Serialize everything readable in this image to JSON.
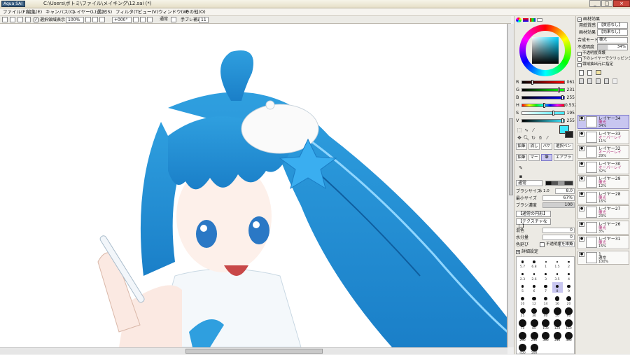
{
  "window": {
    "logo": "Aqua SAI",
    "title": "C:\\Users\\ボトミ\\ファイル\\メイキング\\12.sai (*)",
    "min": "_",
    "max": "□",
    "close": "×"
  },
  "menu": [
    "ファイル(F)",
    "編集(E)",
    "キャンバス(C)",
    "レイヤー(L)",
    "選択(S)",
    "フィルタ(T)",
    "ビュー(V)",
    "ウィンドウ(W)",
    "その他(O)"
  ],
  "toolbar": {
    "show_selection_label": "選択領域表示",
    "zoom": "100%",
    "angle": "+000°",
    "blend": "通常",
    "stabilizer_label": "手ブレ補正",
    "stabilizer": "11"
  },
  "color": {
    "sliders": [
      {
        "label": "R",
        "value": "061",
        "gradient": "linear-gradient(90deg,#000,#f00)",
        "level": 0.24
      },
      {
        "label": "G",
        "value": "231",
        "gradient": "linear-gradient(90deg,#000,#0f0)",
        "level": 0.91
      },
      {
        "label": "B",
        "value": "255",
        "gradient": "linear-gradient(90deg,#000,#00f)",
        "level": 1.0
      },
      {
        "label": "H",
        "value": "0.532",
        "gradient": "linear-gradient(90deg,#f00,#ff0,#0f0,#0ff,#00f,#f0f,#f00)",
        "level": 0.53
      },
      {
        "label": "S",
        "value": "195",
        "gradient": "linear-gradient(90deg,#fff,#3de7ff)",
        "level": 0.76
      },
      {
        "label": "V",
        "value": "255",
        "gradient": "linear-gradient(90deg,#000,#3de7ff)",
        "level": 1.0
      }
    ],
    "current": "#3de7ff",
    "brush_row1": [
      "鉛筆",
      "消しゴム",
      "バケツ",
      "選択ペン"
    ],
    "brush_row2": [
      "鉛筆",
      "マーカー",
      "筆",
      "エアブラシ"
    ],
    "blend_mode": "通常",
    "brush_size_label": "ブラシサイズ",
    "brush_size_mult": "x 1.0",
    "brush_size": "8.0",
    "min_size_label": "最小サイズ",
    "min_size": "67%",
    "density_label": "ブラシ濃度",
    "density": "100",
    "shape_label": "【通常の円形】",
    "texture_label": "【テクスチャなし】",
    "blend_label": "混色",
    "blend_val": "0",
    "water_label": "水分量",
    "water_val": "0",
    "stretch_label": "色延び",
    "stretch_val": "0",
    "keep_opacity_label": "不透明度を維持",
    "detail_label": "詳細設定",
    "sizes": [
      "5.7",
      "6.8",
      "1",
      "1.5",
      "2",
      "2.3",
      "2.6",
      "3",
      "3.5",
      "4",
      "5",
      "6",
      "7",
      "8",
      "9",
      "10",
      "12",
      "14",
      "16",
      "20",
      "25",
      "30",
      "40",
      "50",
      "60",
      "70",
      "80",
      "100",
      "120",
      "160",
      "200",
      "250",
      "300",
      "350",
      "400",
      "450",
      "500"
    ]
  },
  "layers": {
    "texture_header": "画材効果",
    "paper_label": "用紙質感",
    "paper_value": "【質感なし】",
    "effect_label": "画材効果",
    "effect_value": "【効果なし】",
    "mode_label": "合成モード",
    "mode_value": "覆光",
    "opacity_label": "不透明度",
    "opacity_value": "34%",
    "protect_label": "不透明度保護",
    "clip_label": "下のレイヤーでクリッピング",
    "sel_label": "領域抽出元に指定",
    "items": [
      {
        "name": "レイヤー34",
        "mode": "覆光",
        "op": "34%",
        "selected": true
      },
      {
        "name": "レイヤー33",
        "mode": "オーバーレイ",
        "op": "11%",
        "selected": false
      },
      {
        "name": "レイヤー32",
        "mode": "オーバーレイ",
        "op": "29%",
        "selected": false
      },
      {
        "name": "レイヤー30",
        "mode": "オーバーレイ",
        "op": "32%",
        "selected": false
      },
      {
        "name": "レイヤー29",
        "mode": "覆光",
        "op": "12%",
        "selected": false
      },
      {
        "name": "レイヤー28",
        "mode": "覆光",
        "op": "16%",
        "selected": false
      },
      {
        "name": "レイヤー27",
        "mode": "覆光",
        "op": "23%",
        "selected": false
      },
      {
        "name": "レイヤー26",
        "mode": "覆光",
        "op": "3%",
        "selected": false
      },
      {
        "name": "レイヤー31",
        "mode": "覆光",
        "op": "15%",
        "selected": false
      },
      {
        "name": "1",
        "mode": "通常",
        "op": "100%",
        "selected": false
      }
    ]
  }
}
